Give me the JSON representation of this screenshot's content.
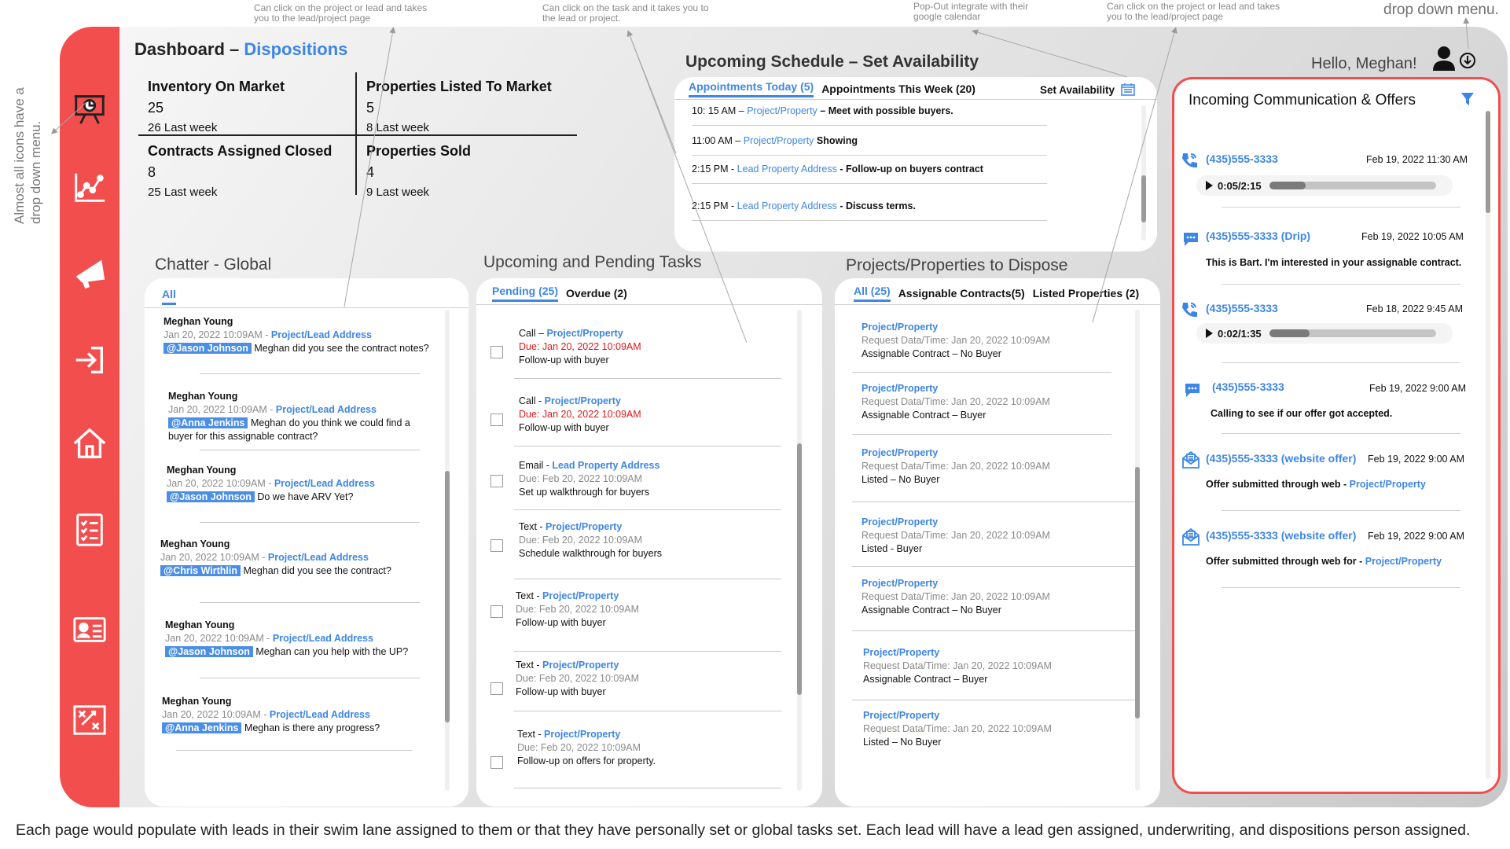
{
  "annotations": {
    "top1": "Can click on the project or lead and takes you to the lead/project page",
    "top2": "Can click on the task and it takes you to the lead or project.",
    "top3": "Pop-Out integrate with their google calendar",
    "top4": "Can click on the project or lead and takes you to the lead/project page",
    "top5": "drop down menu.",
    "side": "Almost all icons have a drop down menu.",
    "footer": "Each page would populate with leads in their swim lane assigned to them or that they have personally set or global tasks set. Each lead will have a lead gen assigned, underwriting, and dispositions person assigned."
  },
  "header": {
    "title_prefix": "Dashboard – ",
    "title_page": "Dispositions",
    "greeting": "Hello, Meghan!"
  },
  "sidebar_icons": [
    "presentation-icon",
    "analytics-icon",
    "megaphone-icon",
    "sign-in-icon",
    "home-icon",
    "checklist-icon",
    "contact-card-icon",
    "strategy-icon"
  ],
  "kpis": [
    {
      "label": "Inventory On Market",
      "value": "25",
      "sub": "26 Last week"
    },
    {
      "label": "Properties Listed To Market",
      "value": "5",
      "sub": "8 Last week"
    },
    {
      "label": "Contracts Assigned Closed",
      "value": "8",
      "sub": "25 Last week"
    },
    {
      "label": "Properties Sold",
      "value": "4",
      "sub": "9 Last week"
    }
  ],
  "schedule": {
    "title": "Upcoming Schedule – Set Availability",
    "tab_today": "Appointments Today (5)",
    "tab_week": "Appointments This Week (20)",
    "set_availability": "Set Availability",
    "rows": [
      {
        "time": "10: 15 AM – ",
        "link": "Project/Property",
        "text": " – Meet with possible buyers."
      },
      {
        "time": "11:00 AM – ",
        "link": "Project/Property",
        "text": "  Showing"
      },
      {
        "time": "2:15 PM - ",
        "link": "Lead Property Address",
        "text": "  -  Follow-up on buyers contract"
      },
      {
        "time": "2:15 PM - ",
        "link": "Lead Property Address",
        "text": "  -  Discuss terms."
      }
    ]
  },
  "chatter": {
    "title": "Chatter - Global",
    "tab_all": "All",
    "items": [
      {
        "name": "Meghan Young",
        "date": "Jan 20, 2022  10:09AM - ",
        "link": "Project/Lead Address",
        "mention": "@Jason Johnson",
        "msg": " Meghan did you see the contract notes?"
      },
      {
        "name": "Meghan Young",
        "date": "Jan 20, 2022  10:09AM - ",
        "link": "Project/Lead Address",
        "mention": "@Anna Jenkins",
        "msg": " Meghan do you think we could find a buyer for this assignable contract?"
      },
      {
        "name": "Meghan Young",
        "date": "Jan 20, 2022  10:09AM - ",
        "link": "Project/Lead Address",
        "mention": "@Jason Johnson",
        "msg": " Do we have ARV Yet?"
      },
      {
        "name": "Meghan Young",
        "date": "Jan 20, 2022  10:09AM - ",
        "link": "Project/Lead Address",
        "mention": "@Chris Wirthlin",
        "msg": " Meghan did you see the contract?"
      },
      {
        "name": "Meghan Young",
        "date": "Jan 20, 2022  10:09AM - ",
        "link": "Project/Lead Address",
        "mention": "@Jason Johnson",
        "msg": " Meghan can you help with the UP?"
      },
      {
        "name": "Meghan Young",
        "date": "Jan 20, 2022  10:09AM - ",
        "link": "Project/Lead Address",
        "mention": "@Anna Jenkins",
        "msg": " Meghan is there any progress?"
      }
    ]
  },
  "tasks": {
    "title": "Upcoming and Pending Tasks",
    "tab_pending": "Pending (25)",
    "tab_overdue": "Overdue (2)",
    "items": [
      {
        "type": "Call – ",
        "link": "Project/Property",
        "due": "Due: Jan 20, 2022  10:09AM",
        "overdue": true,
        "desc": "Follow-up with buyer"
      },
      {
        "type": "Call - ",
        "link": "Project/Property",
        "due": "Due: Jan 20, 2022  10:09AM",
        "overdue": true,
        "desc": "Follow-up with buyer"
      },
      {
        "type": "Email - ",
        "link": "Lead Property Address",
        "due": "Due: Feb 20, 2022  10:09AM",
        "overdue": false,
        "desc": "Set up walkthrough for buyers"
      },
      {
        "type": "Text - ",
        "link": "Project/Property",
        "due": "Due: Feb 20, 2022  10:09AM",
        "overdue": false,
        "desc": "Schedule walkthrough for buyers"
      },
      {
        "type": "Text - ",
        "link": "Project/Property",
        "due": "Due: Feb 20, 2022  10:09AM",
        "overdue": false,
        "desc": "Follow-up with buyer"
      },
      {
        "type": "Text - ",
        "link": "Project/Property",
        "due": "Due: Feb 20, 2022  10:09AM",
        "overdue": false,
        "desc": "Follow-up with buyer"
      },
      {
        "type": "Text - ",
        "link": "Project/Property",
        "due": "Due: Feb 20, 2022  10:09AM",
        "overdue": false,
        "desc": "Follow-up on offers for property."
      }
    ]
  },
  "projects": {
    "title": "Projects/Properties to Dispose",
    "tab_all": "All (25)",
    "tab_assignable": "Assignable Contracts(5)",
    "tab_listed": "Listed Properties (2)",
    "items": [
      {
        "link": "Project/Property",
        "req": "Request Data/Time: Jan 20, 2022  10:09AM",
        "status": "Assignable Contract – No Buyer"
      },
      {
        "link": "Project/Property",
        "req": "Request Data/Time: Jan 20, 2022  10:09AM",
        "status": "Assignable Contract – Buyer"
      },
      {
        "link": "Project/Property",
        "req": "Request Data/Time: Jan 20, 2022  10:09AM",
        "status": "Listed – No Buyer"
      },
      {
        "link": "Project/Property",
        "req": "Request Data/Time: Jan 20, 2022  10:09AM",
        "status": "Listed - Buyer"
      },
      {
        "link": "Project/Property",
        "req": "Request Data/Time: Jan 20, 2022  10:09AM",
        "status": "Assignable Contract – No Buyer"
      },
      {
        "link": "Project/Property",
        "req": "Request Data/Time: Jan 20, 2022  10:09AM",
        "status": "Assignable Contract – Buyer"
      },
      {
        "link": "Project/Property",
        "req": "Request Data/Time: Jan 20, 2022  10:09AM",
        "status": "Listed – No Buyer"
      }
    ]
  },
  "communication": {
    "title": "Incoming Communication & Offers",
    "items": [
      {
        "icon": "phone-call-icon",
        "phone": "(435)555-3333",
        "date": "Feb 19, 2022  11:30 AM",
        "audio": "0:05/2:15",
        "progress": 0.22
      },
      {
        "icon": "message-icon",
        "phone": "(435)555-3333 (Drip)",
        "date": "Feb 19, 2022  10:05 AM",
        "text": "This is Bart. I'm interested in your assignable contract."
      },
      {
        "icon": "phone-call-icon",
        "phone": "(435)555-3333",
        "date": "Feb 18, 2022  9:45 AM",
        "audio": "0:02/1:35",
        "progress": 0.24
      },
      {
        "icon": "message-icon",
        "phone": "(435)555-3333",
        "date": "Feb 19, 2022  9:00 AM",
        "text": "Calling to see if our offer got accepted."
      },
      {
        "icon": "envelope-offer-icon",
        "phone": "(435)555-3333 (website offer)",
        "date": "Feb 19, 2022  9:00 AM",
        "text": "Offer submitted through web - ",
        "link": "Project/Property"
      },
      {
        "icon": "envelope-offer-icon",
        "phone": "(435)555-3333 (website offer)",
        "date": "Feb 19, 2022  9:00 AM",
        "text": "Offer submitted through web for - ",
        "link": "Project/Property"
      }
    ]
  },
  "colors": {
    "accent": "#3d86e6",
    "sidebar": "#f24e4e",
    "overdue": "#e01818"
  }
}
